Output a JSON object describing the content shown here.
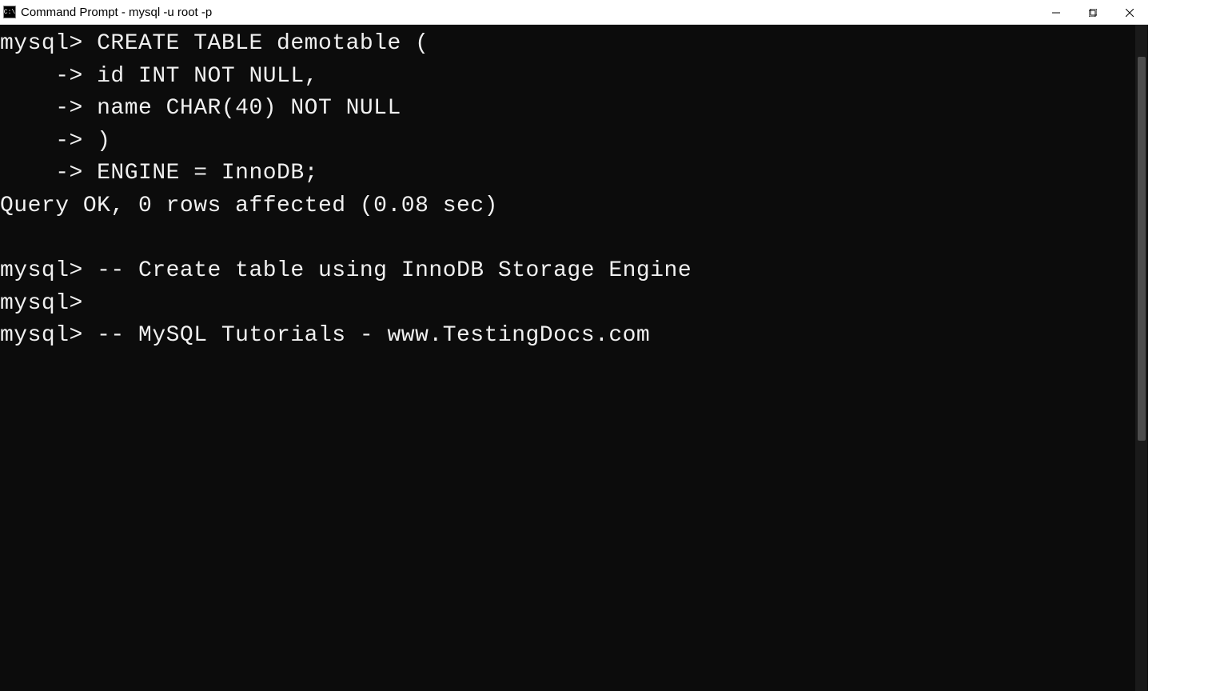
{
  "titlebar": {
    "title": "Command Prompt - mysql  -u root -p"
  },
  "terminal": {
    "lines": [
      "mysql> CREATE TABLE demotable (",
      "    -> id INT NOT NULL,",
      "    -> name CHAR(40) NOT NULL",
      "    -> )",
      "    -> ENGINE = InnoDB;",
      "Query OK, 0 rows affected (0.08 sec)",
      "",
      "mysql> -- Create table using InnoDB Storage Engine",
      "mysql>",
      "mysql> -- MySQL Tutorials - www.TestingDocs.com"
    ]
  }
}
